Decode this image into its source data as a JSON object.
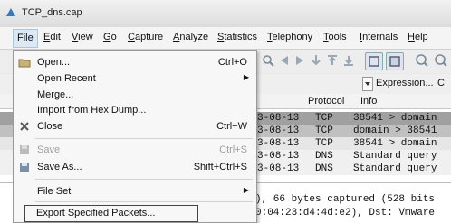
{
  "window": {
    "title": "TCP_dns.cap"
  },
  "menubar": [
    "File",
    "Edit",
    "View",
    "Go",
    "Capture",
    "Analyze",
    "Statistics",
    "Telephony",
    "Tools",
    "Internals",
    "Help"
  ],
  "filterbar": {
    "expression_label": "Expression...",
    "next": "C"
  },
  "packet_list": {
    "headers": {
      "protocol": "Protocol",
      "info": "Info"
    },
    "rows": [
      {
        "time": "3-08-13",
        "protocol": "TCP",
        "info": "38541 > domain"
      },
      {
        "time": "3-08-13",
        "protocol": "TCP",
        "info": "domain > 38541"
      },
      {
        "time": "3-08-13",
        "protocol": "TCP",
        "info": "38541 > domain"
      },
      {
        "time": "3-08-13",
        "protocol": "DNS",
        "info": "Standard query"
      },
      {
        "time": "3-08-13",
        "protocol": "DNS",
        "info": "Standard query"
      }
    ]
  },
  "detail": {
    "line1": "), 66 bytes captured (528 bits",
    "line2": "0:04:23:d4:4d:e2), Dst: Vmware"
  },
  "file_menu": {
    "open": {
      "label": "Open...",
      "shortcut": "Ctrl+O"
    },
    "open_recent": {
      "label": "Open Recent"
    },
    "merge": {
      "label": "Merge..."
    },
    "import_hex": {
      "label": "Import from Hex Dump..."
    },
    "close": {
      "label": "Close",
      "shortcut": "Ctrl+W"
    },
    "save": {
      "label": "Save",
      "shortcut": "Ctrl+S"
    },
    "save_as": {
      "label": "Save As...",
      "shortcut": "Shift+Ctrl+S"
    },
    "file_set": {
      "label": "File Set"
    },
    "export_specified": {
      "label": "Export Specified Packets..."
    }
  },
  "colors": {
    "row_dark": "#a0a0a0",
    "row_light": "#e6e6e6",
    "menu_highlight": "#dbe8f6"
  }
}
